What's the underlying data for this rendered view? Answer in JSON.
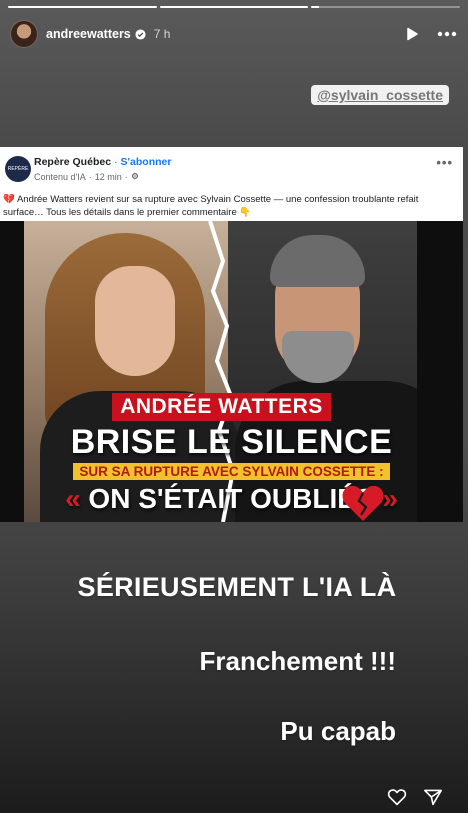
{
  "story": {
    "progress_segments": [
      1,
      1,
      0.05
    ],
    "user": {
      "username": "andreewatters",
      "time": "7 h"
    },
    "mention": "@sylvain_cossette"
  },
  "post": {
    "page_name": "Repère Québec",
    "subscribe_label": "S'abonner",
    "logo_text": "REPÈRE",
    "meta_source": "Contenu d'IA",
    "meta_time": "12 min",
    "text": "💔 Andrée Watters revient sur sa rupture avec Sylvain Cossette — une confession troublante refait surface… Tous les détails dans le premier commentaire 👇",
    "headline": {
      "line1": "ANDRÉE WATTERS",
      "line2": "BRISE LE SILENCE",
      "line3": "SUR SA RUPTURE AVEC SYLVAIN COSSETTE :",
      "line4_open": "«",
      "line4": "ON S'ÉTAIT OUBLIÉS",
      "line4_close": "»"
    }
  },
  "captions": {
    "c1": "SÉRIEUSEMENT L'IA LÀ",
    "c2": "Franchement !!!",
    "c3": "Pu capab"
  },
  "icons": {
    "verified": "verified-badge-icon",
    "play": "play-icon",
    "more": "more-icon",
    "like": "heart-icon",
    "share": "send-icon"
  },
  "colors": {
    "accent_red": "#c8101e",
    "accent_yellow": "#f2c12e",
    "fb_blue": "#1877f2"
  }
}
